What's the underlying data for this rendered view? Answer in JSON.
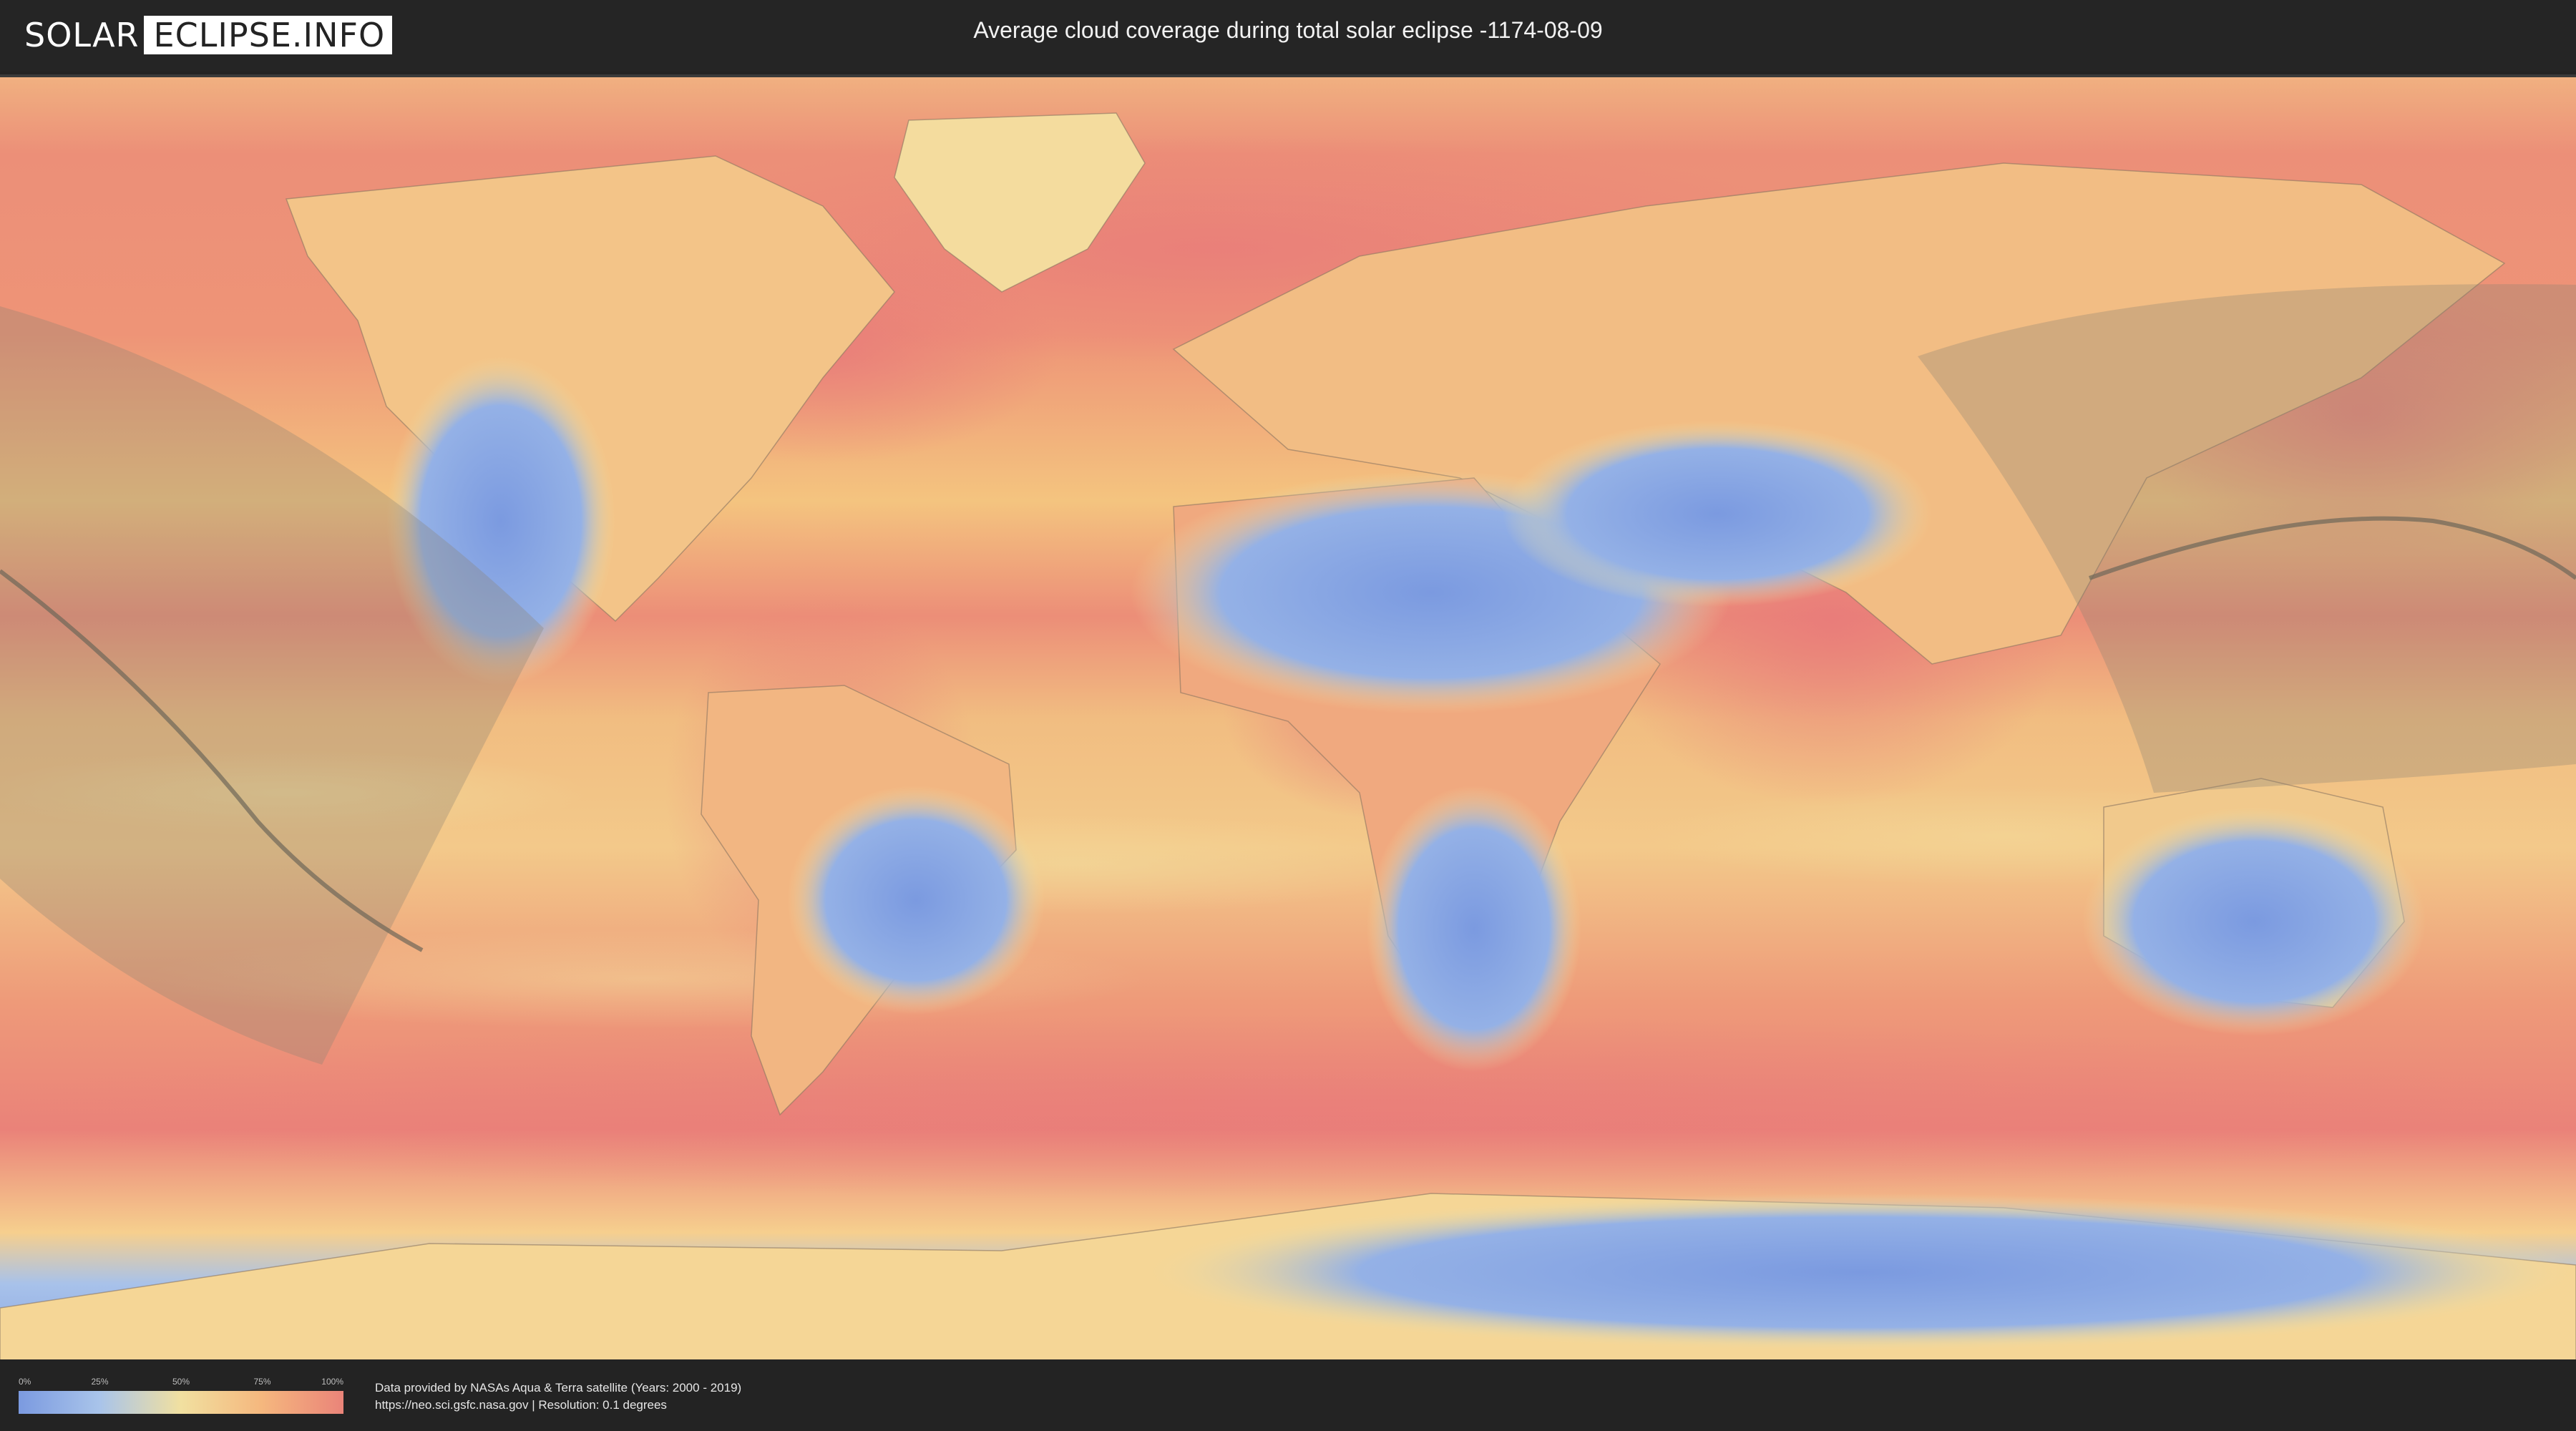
{
  "header": {
    "logo_part1": "SOLAR",
    "logo_part2": "ECLIPSE.INFO",
    "title": "Average cloud coverage during total solar eclipse -1174-08-09"
  },
  "legend": {
    "ticks": [
      "0%",
      "25%",
      "50%",
      "75%",
      "100%"
    ],
    "colors": [
      "#7b9ae0",
      "#a9c4ea",
      "#f1e0a0",
      "#f5b77e",
      "#ea8479"
    ]
  },
  "credits": {
    "line1": "Data provided by NASAs Aqua & Terra satellite (Years: 2000 - 2019)",
    "line2": "https://neo.sci.gsfc.nasa.gov | Resolution: 0.1 degrees"
  },
  "map": {
    "colors": {
      "ocean_high_cloud": "#ea8479",
      "ocean_mid_cloud": "#f5b77e",
      "low_cloud": "#f1e0a0",
      "clear_sky": "#7b9ae0",
      "eclipse_shadow": "#8c8474",
      "central_line": "#6e6658"
    }
  }
}
